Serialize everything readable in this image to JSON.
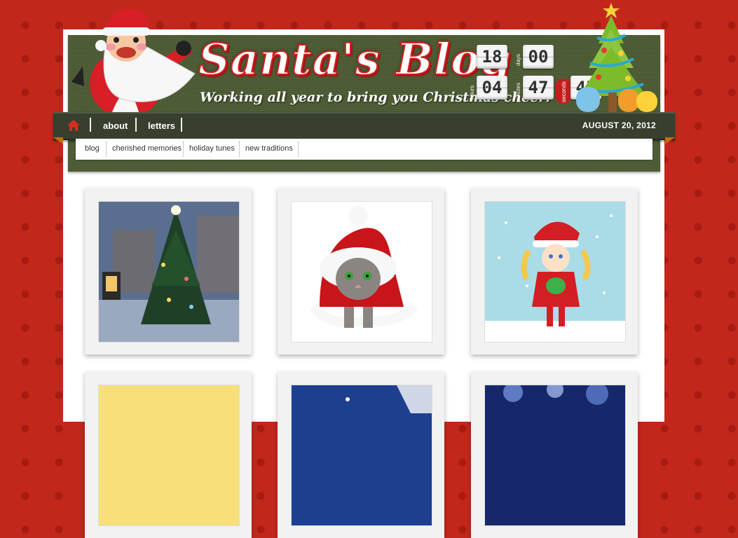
{
  "header": {
    "title": "Santa's Blog",
    "tagline": "Working all year to bring you Christmas cheer!"
  },
  "countdown": {
    "weeks": {
      "value": "18",
      "label": "weeks"
    },
    "days": {
      "value": "00",
      "label": "days"
    },
    "hours": {
      "value": "04",
      "label": "hours"
    },
    "minutes": {
      "value": "47",
      "label": "minutes"
    },
    "seconds": {
      "value": "45",
      "label": "seconds"
    }
  },
  "nav": {
    "items": [
      "about",
      "letters"
    ],
    "date": "AUGUST 20, 2012"
  },
  "subnav": {
    "items": [
      "blog",
      "cherished memories",
      "holiday tunes",
      "new traditions"
    ]
  },
  "colors": {
    "background": "#c3271c",
    "header": "#4c5b33",
    "navbar": "#383f2e",
    "title_red": "#d11f1f"
  },
  "gallery": [
    {
      "icon": "christmas-tree-photo"
    },
    {
      "icon": "kitten-santa-hat-photo"
    },
    {
      "icon": "christmas-girl-snow-photo"
    },
    {
      "icon": "yellow-photo"
    },
    {
      "icon": "blue-stars-photo"
    },
    {
      "icon": "bokeh-lights-photo"
    }
  ]
}
